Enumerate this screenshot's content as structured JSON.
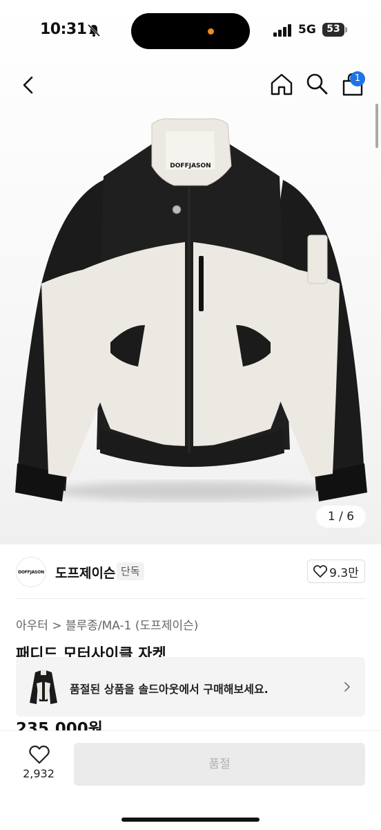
{
  "status_bar": {
    "time": "10:31",
    "network": "5G",
    "battery": "53"
  },
  "nav": {
    "cart_count": "1"
  },
  "hero": {
    "logo_text": "DOFFJASON",
    "pager": "1 / 6"
  },
  "brand": {
    "logo_text": "DOFFJASON",
    "name": "도프제이슨",
    "tag": "단독",
    "likes": "9.3만"
  },
  "product": {
    "breadcrumb": "아우터 > 블루종/MA-1 (도프제이슨)",
    "title": "패디드 모터사이클 자켓",
    "price": "235,000원"
  },
  "soldout_banner": {
    "text": "품절된 상품을 솔드아웃에서 구매해보세요."
  },
  "bottom_bar": {
    "like_count": "2,932",
    "buy_label": "품절"
  },
  "colors": {
    "accent": "#1e74e6",
    "sold_out_button": "#ebebeb",
    "jacket_dark": "#1a1a1a",
    "jacket_light": "#ece9e2"
  },
  "icons": [
    "bell-slash-icon",
    "signal-icon",
    "battery-icon",
    "back-icon",
    "home-icon",
    "search-icon",
    "cart-icon",
    "heart-icon",
    "chevron-right-icon"
  ]
}
